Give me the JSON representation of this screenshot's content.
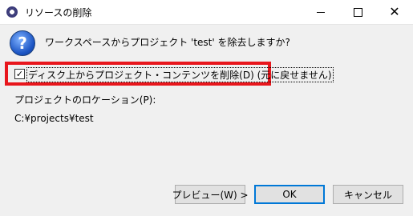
{
  "window": {
    "title": "リソースの削除",
    "close_glyph": "✕"
  },
  "dialog": {
    "icon": "question-icon",
    "icon_glyph": "?",
    "message": "ワークスペースからプロジェクト 'test' を除去しますか?",
    "delete_contents": {
      "checked": true,
      "check_glyph": "✓",
      "label": "ディスク上からプロジェクト・コンテンツを削除(D) (元に戻せません)"
    },
    "location_label": "プロジェクトのロケーション(P):",
    "location_value": "C:¥projects¥test"
  },
  "buttons": {
    "preview": "プレビュー(W) >",
    "ok": "OK",
    "cancel": "キャンセル"
  },
  "colors": {
    "highlight": "#e8161c",
    "default_button_border": "#0078d7"
  }
}
